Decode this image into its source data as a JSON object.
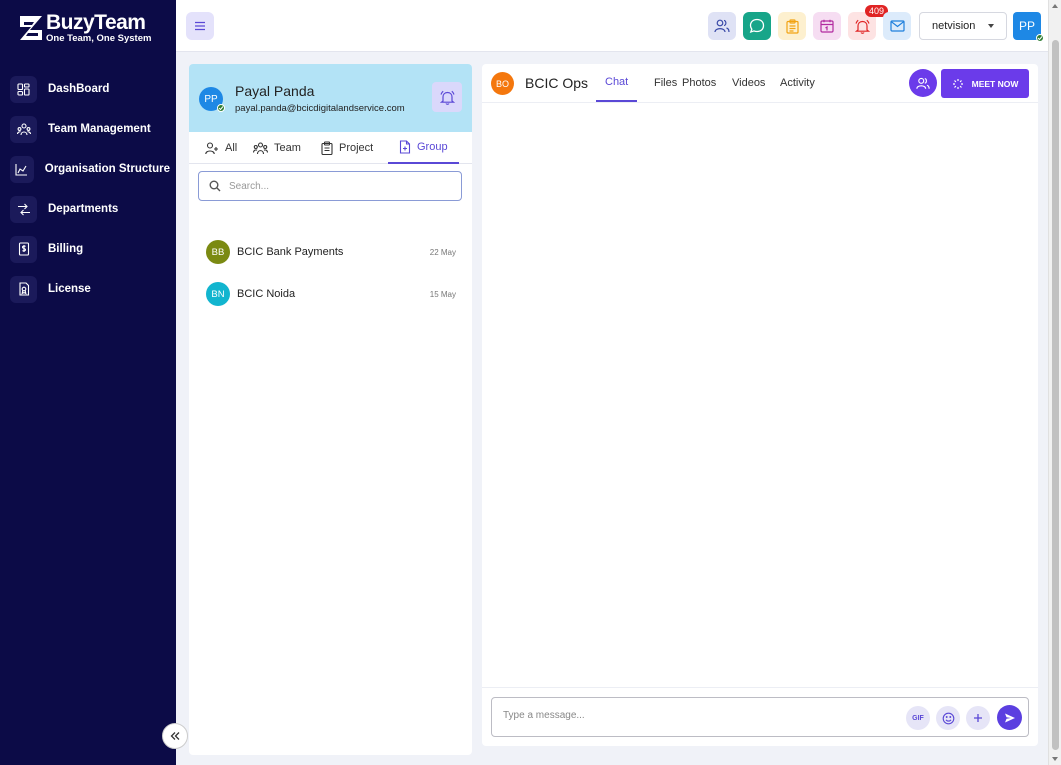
{
  "brand": {
    "title": "BuzyTeam",
    "tagline": "One Team, One System"
  },
  "sidebar": {
    "items": [
      {
        "label": "DashBoard",
        "icon": "dashboard-icon"
      },
      {
        "label": "Team Management",
        "icon": "team-icon"
      },
      {
        "label": "Organisation Structure",
        "icon": "chart-icon"
      },
      {
        "label": "Departments",
        "icon": "swap-icon"
      },
      {
        "label": "Billing",
        "icon": "billing-icon"
      },
      {
        "label": "License",
        "icon": "license-icon"
      }
    ]
  },
  "topbar": {
    "notification_count": "409",
    "org_select": "netvision",
    "user_initials": "PP",
    "icons": [
      "people-icon",
      "chat-icon",
      "clipboard-icon",
      "calendar-icon",
      "bell-icon",
      "mail-icon"
    ]
  },
  "profile": {
    "initials": "PP",
    "name": "Payal Panda",
    "email": "payal.panda@bcicdigitalandservice.com"
  },
  "left_tabs": [
    {
      "label": "All",
      "active": false
    },
    {
      "label": "Team",
      "active": false
    },
    {
      "label": "Project",
      "active": false
    },
    {
      "label": "Group",
      "active": true
    }
  ],
  "search": {
    "placeholder": "Search..."
  },
  "groups": [
    {
      "initials": "BB",
      "name": "BCIC Bank Payments",
      "date": "22 May",
      "color": "#7b8a12"
    },
    {
      "initials": "BN",
      "name": "BCIC Noida",
      "date": "15 May",
      "color": "#12b5cf"
    }
  ],
  "chat": {
    "initials": "BO",
    "title": "BCIC Ops",
    "tabs": [
      {
        "label": "Chat",
        "active": true
      },
      {
        "label": "Files",
        "active": false
      },
      {
        "label": "Photos",
        "active": false
      },
      {
        "label": "Videos",
        "active": false
      },
      {
        "label": "Activity",
        "active": false
      }
    ],
    "meet_label": "MEET NOW",
    "composer_placeholder": "Type a message...",
    "gif_label": "GIF"
  },
  "colors": {
    "sidebar_bg": "#0c0b47",
    "accent": "#5a48d6",
    "meet_bg": "#6b3bea",
    "profile_bg": "#b3e3f6"
  }
}
